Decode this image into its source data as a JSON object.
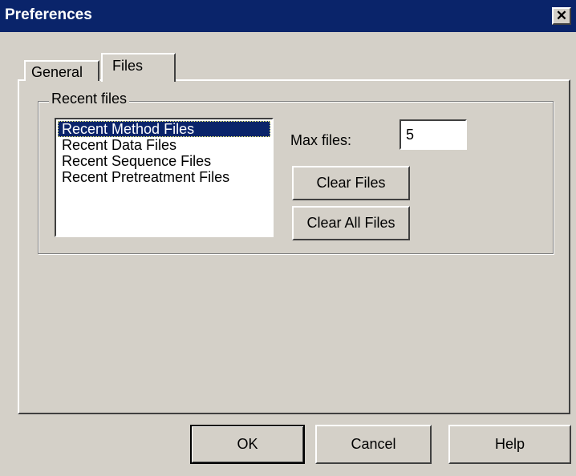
{
  "window": {
    "title": "Preferences",
    "close_glyph": "✕"
  },
  "tabs": [
    {
      "label": "General",
      "active": false
    },
    {
      "label": "Files",
      "active": true
    }
  ],
  "recent_files": {
    "group_label": "Recent files",
    "list_items": [
      {
        "label": "Recent Method Files",
        "selected": true
      },
      {
        "label": "Recent Data Files",
        "selected": false
      },
      {
        "label": "Recent Sequence Files",
        "selected": false
      },
      {
        "label": "Recent Pretreatment Files",
        "selected": false
      }
    ],
    "max_files_label": "Max files:",
    "max_files_value": "5",
    "clear_files_label": "Clear Files",
    "clear_all_files_label": "Clear All Files"
  },
  "footer": {
    "ok_label": "OK",
    "cancel_label": "Cancel",
    "help_label": "Help"
  },
  "colors": {
    "titlebar": "#0a246a",
    "face": "#d4d0c8",
    "selection": "#0a246a"
  }
}
